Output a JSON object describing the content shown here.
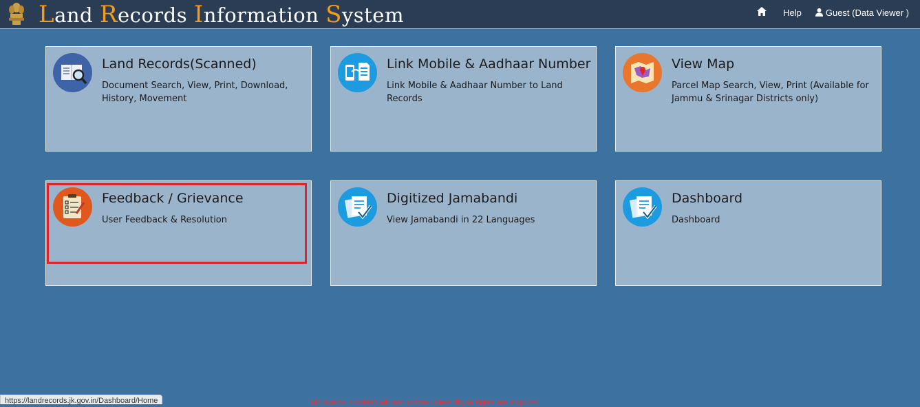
{
  "header": {
    "title_letters": [
      {
        "cap": "L",
        "rest": "and"
      },
      {
        "cap": "R",
        "rest": "ecords"
      },
      {
        "cap": "I",
        "rest": "nformation"
      },
      {
        "cap": "S",
        "rest": "ystem"
      }
    ],
    "nav": {
      "home_icon": "home-icon",
      "help_label": "Help",
      "user_label": "Guest (Data Viewer )"
    }
  },
  "cards": [
    {
      "title": "Land Records(Scanned)",
      "desc": "Document Search, View, Print, Download, History, Movement",
      "icon": "document-search-icon",
      "color": "#3f63a8"
    },
    {
      "title": "Link Mobile & Aadhaar Number",
      "desc": "Link Mobile & Aadhaar Number to Land Records",
      "icon": "mobile-link-icon",
      "color": "#1d9be0"
    },
    {
      "title": "View Map",
      "desc": "Parcel Map Search, View, Print (Available for Jammu & Srinagar Districts only)",
      "icon": "map-icon",
      "color": "#e8762d"
    },
    {
      "title": "Feedback / Grievance",
      "desc": "User Feedback & Resolution",
      "icon": "clipboard-checklist-icon",
      "color": "#e0581e"
    },
    {
      "title": "Digitized Jamabandi",
      "desc": "View Jamabandi in 22 Languages",
      "icon": "document-check-icon",
      "color": "#1d9be0"
    },
    {
      "title": "Dashboard",
      "desc": "Dashboard",
      "icon": "dashboard-document-icon",
      "color": "#1d9be0"
    }
  ],
  "status_bar": {
    "url": "https://landrecords.jk.gov.in/Dashboard/Home"
  },
  "footer": {
    "note": "Information provided will not update unless digital rights are acquired"
  },
  "colors": {
    "header_bg": "#2b3d55",
    "accent": "#f39c1e",
    "page_bg": "#3d72a0",
    "card_bg": "#9ab4cc",
    "highlight": "#e0222b"
  }
}
